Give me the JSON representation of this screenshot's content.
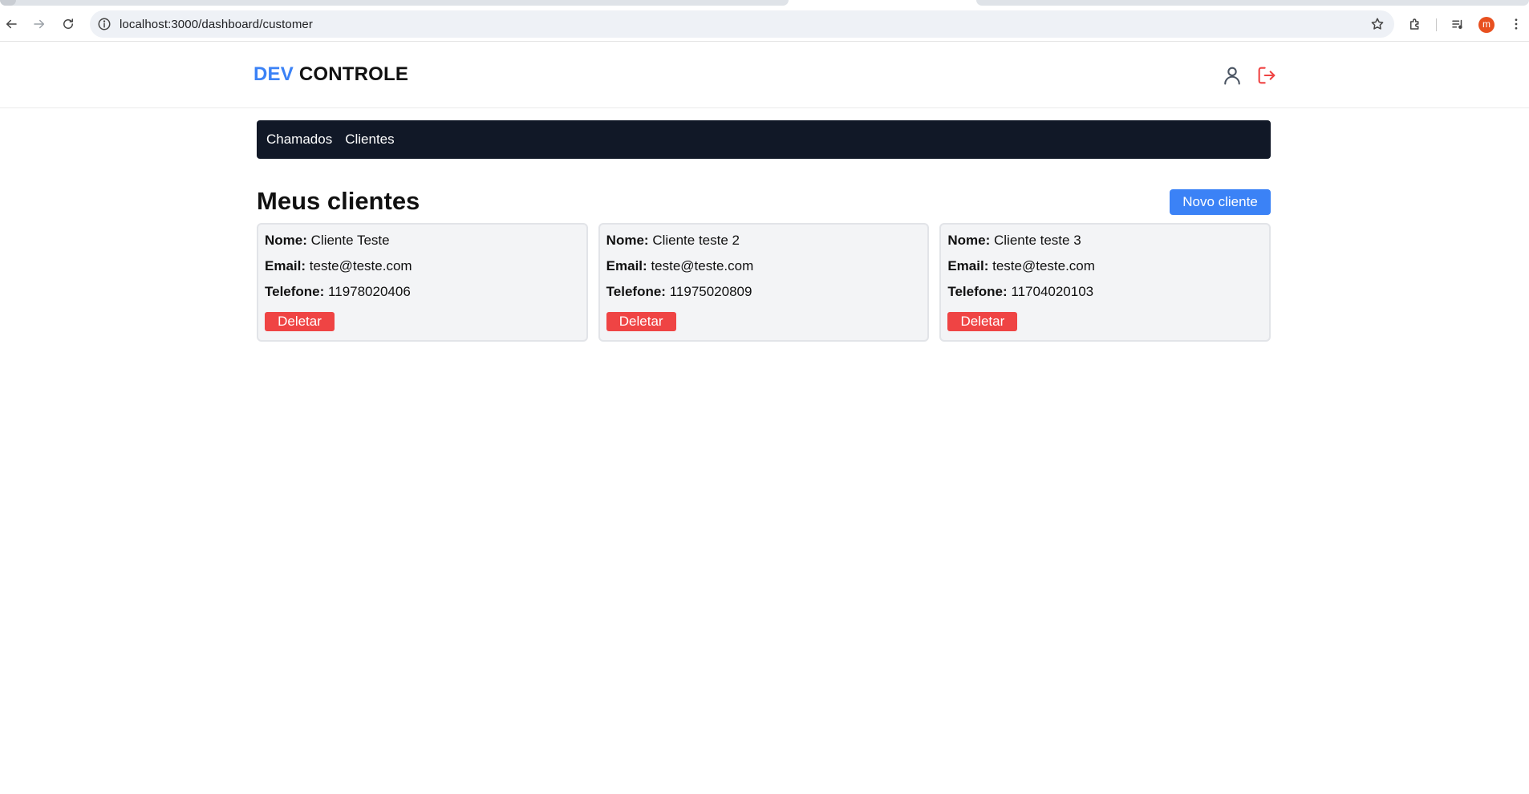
{
  "browser": {
    "url": "localhost:3000/dashboard/customer",
    "avatar_initial": "m"
  },
  "header": {
    "logo_dev": "DEV",
    "logo_rest": " CONTROLE"
  },
  "nav": {
    "items": [
      {
        "label": "Chamados"
      },
      {
        "label": "Clientes"
      }
    ]
  },
  "main": {
    "title": "Meus clientes",
    "new_button": "Novo cliente",
    "labels": {
      "name": "Nome:",
      "email": "Email:",
      "phone": "Telefone:"
    },
    "delete_label": "Deletar",
    "customers": [
      {
        "name": "Cliente Teste",
        "email": "teste@teste.com",
        "phone": "11978020406"
      },
      {
        "name": "Cliente teste 2",
        "email": "teste@teste.com",
        "phone": "11975020809"
      },
      {
        "name": "Cliente teste 3",
        "email": "teste@teste.com",
        "phone": "11704020103"
      }
    ]
  },
  "colors": {
    "accent": "#3b82f6",
    "nav_bg": "#111827",
    "danger": "#ef4444",
    "card_bg": "#f3f4f6"
  }
}
